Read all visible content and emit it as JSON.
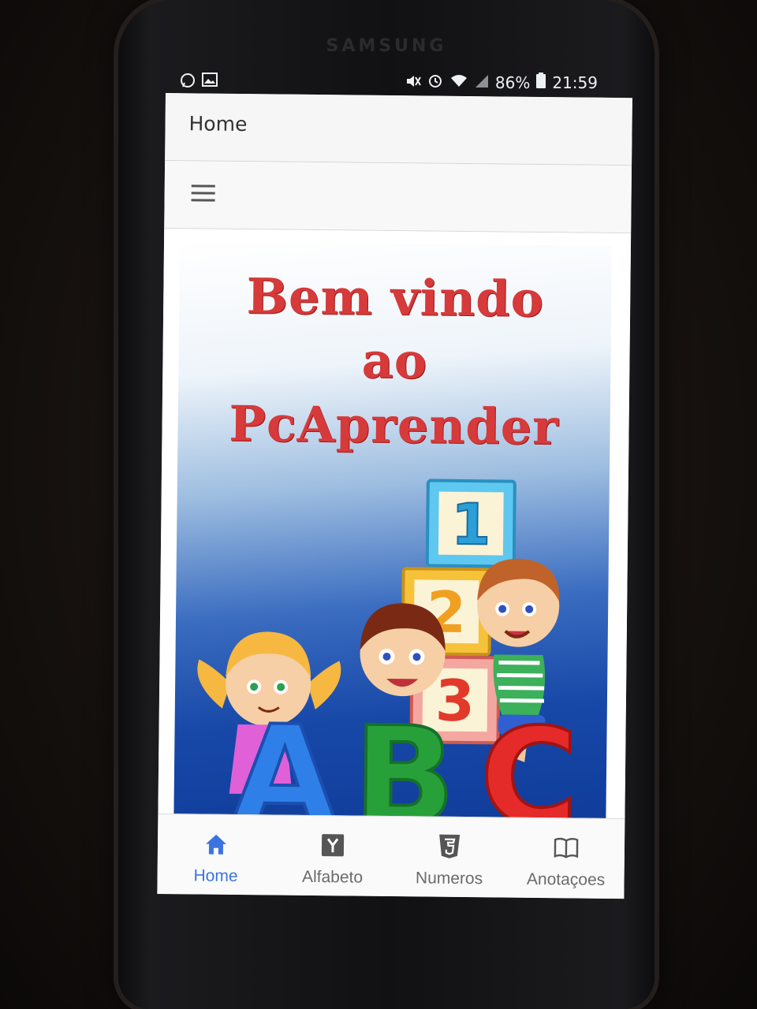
{
  "device": {
    "brand": "SAMSUNG"
  },
  "statusbar": {
    "battery": "86%",
    "time": "21:59"
  },
  "header": {
    "title": "Home"
  },
  "banner": {
    "line1": "Bem vindo",
    "line2": "ao",
    "line3": "PcAprender"
  },
  "illustration": {
    "block_top": "1",
    "block_middle": "2",
    "block_bottom": "3",
    "letters": [
      "A",
      "B",
      "C"
    ]
  },
  "bottom_nav": {
    "tabs": [
      {
        "label": "Home",
        "icon": "home-icon",
        "active": true
      },
      {
        "label": "Alfabeto",
        "icon": "y-square-icon",
        "active": false
      },
      {
        "label": "Numeros",
        "icon": "html5-icon",
        "active": false
      },
      {
        "label": "Anotaçoes",
        "icon": "book-icon",
        "active": false
      }
    ]
  },
  "colors": {
    "accent": "#3b74e0",
    "welcome_text": "#d63a3a",
    "banner_blue": "#1748a8"
  }
}
